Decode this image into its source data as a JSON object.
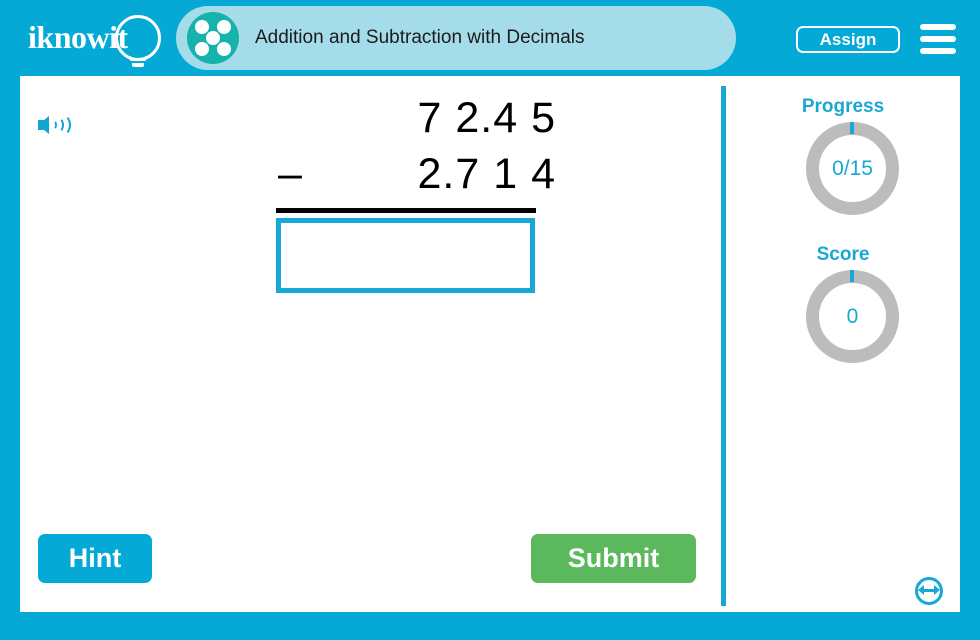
{
  "header": {
    "logo_text": "iknowit",
    "logo_icon": "lightbulb-icon",
    "title": "Addition and Subtraction with Decimals",
    "title_icon": "five-dots-circle-icon",
    "assign_label": "Assign",
    "menu_icon": "hamburger-menu-icon",
    "bar_color": "#05a9d6",
    "pill_color": "#a5dcea",
    "icon_color": "#16b3ad"
  },
  "toolbar": {
    "audio_icon": "speaker-icon"
  },
  "problem": {
    "operand_top": "7 2.4 5",
    "operator": "–",
    "operand_bottom": "2.7 1 4",
    "answer_value": "",
    "answer_placeholder": ""
  },
  "actions": {
    "hint_label": "Hint",
    "hint_color": "#05a9d6",
    "submit_label": "Submit",
    "submit_color": "#5cb85c"
  },
  "sidebar": {
    "progress": {
      "label": "Progress",
      "value": "0/15",
      "completed": 0,
      "total": 15
    },
    "score": {
      "label": "Score",
      "value": "0"
    },
    "ring_color": "#bcbcbc",
    "accent_color": "#1ba7d4"
  },
  "footer": {
    "resize_icon": "horizontal-resize-icon"
  }
}
